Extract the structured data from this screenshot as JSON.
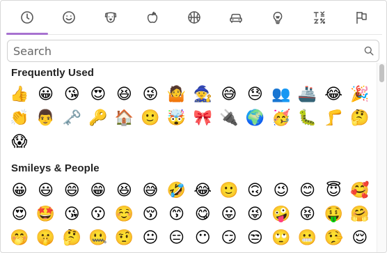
{
  "tabs": [
    {
      "name": "recent",
      "icon": "clock-icon"
    },
    {
      "name": "smileys",
      "icon": "smiley-icon"
    },
    {
      "name": "animals",
      "icon": "dog-icon"
    },
    {
      "name": "food",
      "icon": "apple-icon"
    },
    {
      "name": "activity",
      "icon": "basketball-icon"
    },
    {
      "name": "travel",
      "icon": "car-icon"
    },
    {
      "name": "objects",
      "icon": "lightbulb-icon"
    },
    {
      "name": "symbols",
      "icon": "symbols-icon"
    },
    {
      "name": "flags",
      "icon": "flag-icon"
    }
  ],
  "active_tab": "recent",
  "accent_color": "#a772d0",
  "search": {
    "placeholder": "Search",
    "value": ""
  },
  "sections": [
    {
      "title": "Frequently Used",
      "emojis": [
        "👍",
        "😀",
        "😘",
        "😍",
        "😆",
        "😜",
        "🤷",
        "🧙",
        "😅",
        "😓",
        "👥",
        "🚢",
        "😂",
        "🎉",
        "👏",
        "👨",
        "🗝️",
        "🔑",
        "🏠",
        "🙂",
        "🤯",
        "🎀",
        "🔌",
        "🌍",
        "🥳",
        "🐛",
        "🦵",
        "🤔",
        "😱"
      ]
    },
    {
      "title": "Smileys & People",
      "emojis": [
        "😀",
        "😃",
        "😄",
        "😁",
        "😆",
        "😅",
        "🤣",
        "😂",
        "🙂",
        "🙃",
        "😉",
        "😊",
        "😇",
        "🥰",
        "😍",
        "🤩",
        "😘",
        "😗",
        "☺️",
        "😚",
        "😙",
        "😋",
        "😛",
        "😜",
        "🤪",
        "😝",
        "🤑",
        "🤗",
        "🤭",
        "🤫",
        "🤔",
        "🤐",
        "🤨",
        "😐",
        "😑",
        "😶",
        "😏",
        "😒",
        "🙄",
        "😬",
        "🤥",
        "😌"
      ]
    }
  ]
}
